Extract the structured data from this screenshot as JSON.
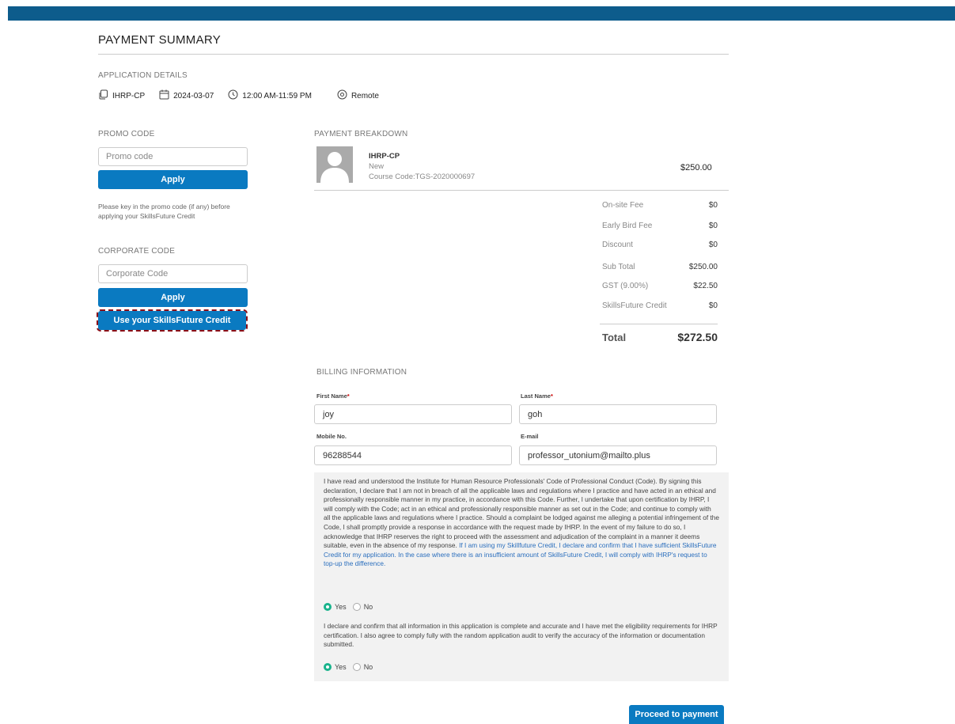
{
  "page_title": "PAYMENT SUMMARY",
  "application": {
    "section_label": "APPLICATION DETAILS",
    "course": "IHRP-CP",
    "date": "2024-03-07",
    "time": "12:00 AM-11:59 PM",
    "location": "Remote"
  },
  "promo": {
    "section_label": "PROMO CODE",
    "placeholder": "Promo code",
    "apply_label": "Apply",
    "help_text": "Please key in the promo code (if any) before applying your SkillsFuture Credit"
  },
  "corporate": {
    "section_label": "CORPORATE CODE",
    "placeholder": "Corporate Code",
    "apply_label": "Apply",
    "skillsfuture_label": "Use your SkillsFuture Credit"
  },
  "breakdown": {
    "section_label": "PAYMENT BREAKDOWN",
    "item": {
      "name": "IHRP-CP",
      "status": "New",
      "code": "Course Code:TGS-2020000697",
      "price": "$250.00"
    },
    "fees": [
      {
        "label": "On-site Fee",
        "value": "$0"
      },
      {
        "label": "Early Bird Fee",
        "value": "$0"
      },
      {
        "label": "Discount",
        "value": "$0"
      },
      {
        "label": "Sub Total",
        "value": "$250.00"
      },
      {
        "label": "GST (9.00%)",
        "value": "$22.50"
      },
      {
        "label": "SkillsFuture Credit",
        "value": "$0"
      }
    ],
    "total_label": "Total",
    "total_value": "$272.50"
  },
  "billing": {
    "section_label": "BILLING INFORMATION",
    "first_name_label": "First Name",
    "first_name": "joy",
    "last_name_label": "Last Name",
    "last_name": "goh",
    "mobile_label": "Mobile No.",
    "mobile": "96288544",
    "email_label": "E-mail",
    "email": "professor_utonium@mailto.plus",
    "required_mark": "*"
  },
  "declaration": {
    "text1": "I have read and understood the Institute for Human Resource Professionals' Code of Professional Conduct (Code). By signing this declaration, I declare that I am not in breach of all the applicable laws and regulations where I practice and have acted in an ethical and professionally responsible manner in my practice, in accordance with this Code. Further, I undertake that upon certification by IHRP, I will comply with the Code; act in an ethical and professionally responsible manner as set out in the Code; and continue to comply with all the applicable laws and regulations where I practice. Should a complaint be lodged against me alleging a potential infringement of the Code, I shall promptly provide a response in accordance with the request made by IHRP. In the event of my failure to do so, I acknowledge that IHRP reserves the right to proceed with the assessment and adjudication of the complaint in a manner it deems suitable, even in the absence of my response.",
    "text1_link": "If I am using my Skillfuture Credit, I declare and confirm that I have sufficient SkillsFuture Credit for my application. In the case where there is an insufficient amount of SkillsFuture Credit, I will comply with IHRP's request to top-up the difference.",
    "text2": "I declare and confirm that all information in this application is complete and accurate and I have met the eligibility requirements for IHRP certification. I also agree to comply fully with the random application audit to verify the accuracy of the information or documentation submitted.",
    "yes_label": "Yes",
    "no_label": "No"
  },
  "proceed_label": "Proceed to payment",
  "colors": {
    "header": "#0d5c8c",
    "primary": "#0a7ac1",
    "radio_selected": "#19b38c",
    "link": "#2a6ebd"
  }
}
